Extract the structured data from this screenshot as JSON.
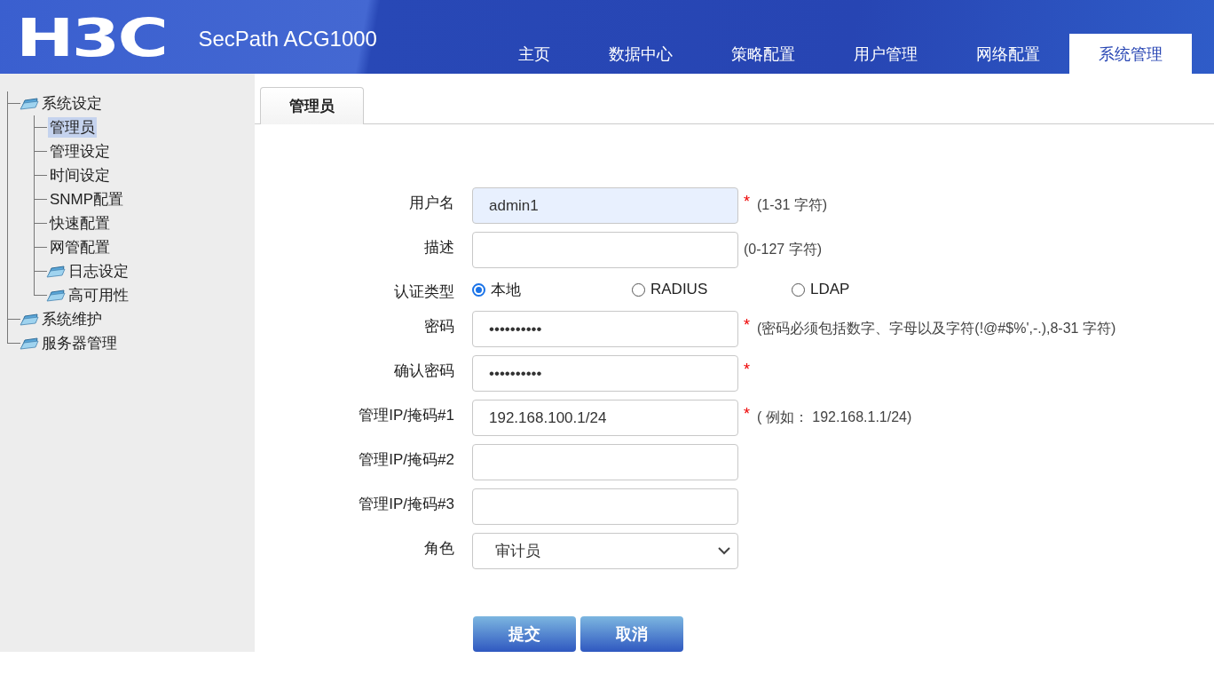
{
  "header": {
    "logo": "H3C",
    "product": "SecPath ACG1000"
  },
  "nav": [
    {
      "label": "主页",
      "selected": false
    },
    {
      "label": "数据中心",
      "selected": false
    },
    {
      "label": "策略配置",
      "selected": false
    },
    {
      "label": "用户管理",
      "selected": false
    },
    {
      "label": "网络配置",
      "selected": false
    },
    {
      "label": "系统管理",
      "selected": true
    }
  ],
  "sidebar": {
    "items": [
      {
        "label": "系统设定",
        "kind": "folder",
        "selected": false,
        "children": [
          {
            "label": "管理员",
            "kind": "leaf",
            "selected": true
          },
          {
            "label": "管理设定",
            "kind": "leaf",
            "selected": false
          },
          {
            "label": "时间设定",
            "kind": "leaf",
            "selected": false
          },
          {
            "label": "SNMP配置",
            "kind": "leaf",
            "selected": false
          },
          {
            "label": "快速配置",
            "kind": "leaf",
            "selected": false
          },
          {
            "label": "网管配置",
            "kind": "leaf",
            "selected": false
          },
          {
            "label": "日志设定",
            "kind": "folder",
            "selected": false
          },
          {
            "label": "高可用性",
            "kind": "folder",
            "selected": false
          }
        ]
      },
      {
        "label": "系统维护",
        "kind": "folder",
        "selected": false
      },
      {
        "label": "服务器管理",
        "kind": "folder",
        "selected": false
      }
    ]
  },
  "tabs": [
    {
      "label": "管理员",
      "selected": true
    }
  ],
  "form": {
    "fields": [
      {
        "label": "用户名",
        "kind": "text",
        "value": "admin1",
        "autofilled": true,
        "required_mark": "*",
        "hint": "(1-31 字符)"
      },
      {
        "label": "描述",
        "kind": "text",
        "autofilled": false,
        "hint": "(0-127 字符)"
      },
      {
        "label": "认证类型",
        "kind": "radio",
        "options": [
          {
            "label": "本地",
            "selected": true
          },
          {
            "label": "RADIUS",
            "selected": false
          },
          {
            "label": "LDAP",
            "selected": false
          }
        ]
      },
      {
        "label": "密码",
        "kind": "text",
        "value": "••••••••••",
        "autofilled": false,
        "required_mark": "*",
        "hint": "(密码必须包括数字、字母以及字符(!@#$%',-.),8-31 字符)"
      },
      {
        "label": "确认密码",
        "kind": "text",
        "value": "••••••••••",
        "autofilled": false,
        "required_mark": "*"
      },
      {
        "label": "管理IP/掩码#1",
        "kind": "text",
        "value": "192.168.100.1/24",
        "autofilled": false,
        "required_mark": "*",
        "hint": "( 例如： 192.168.1.1/24)"
      },
      {
        "label": "管理IP/掩码#2",
        "kind": "text",
        "autofilled": false
      },
      {
        "label": "管理IP/掩码#3",
        "kind": "text",
        "autofilled": false
      },
      {
        "label": "角色",
        "kind": "select",
        "value": "审计员"
      }
    ],
    "buttons": [
      "提交",
      "取消"
    ]
  }
}
